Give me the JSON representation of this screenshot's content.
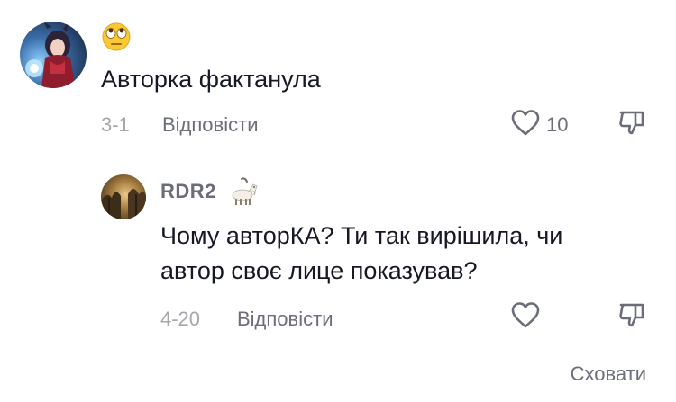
{
  "comment": {
    "username_icon": "face-with-rolling-eyes-emoji",
    "text": "Авторка фактанула",
    "date": "3-1",
    "reply_label": "Відповісти",
    "like_count": "10",
    "avatar": "anime-character-avatar"
  },
  "reply": {
    "username": "RDR2",
    "username_icon": "goat-emoji",
    "text_line1": "Чому авторКА? Ти так вирішила, чи",
    "text_line2": "автор своє лице показував?",
    "date": "4-20",
    "reply_label": "Відповісти",
    "avatar": "forest-avatar"
  },
  "actions": {
    "hide_label": "Сховати"
  },
  "colors": {
    "text_primary": "#161823",
    "text_secondary": "#6b6e78",
    "text_date": "#a5a7ad"
  }
}
